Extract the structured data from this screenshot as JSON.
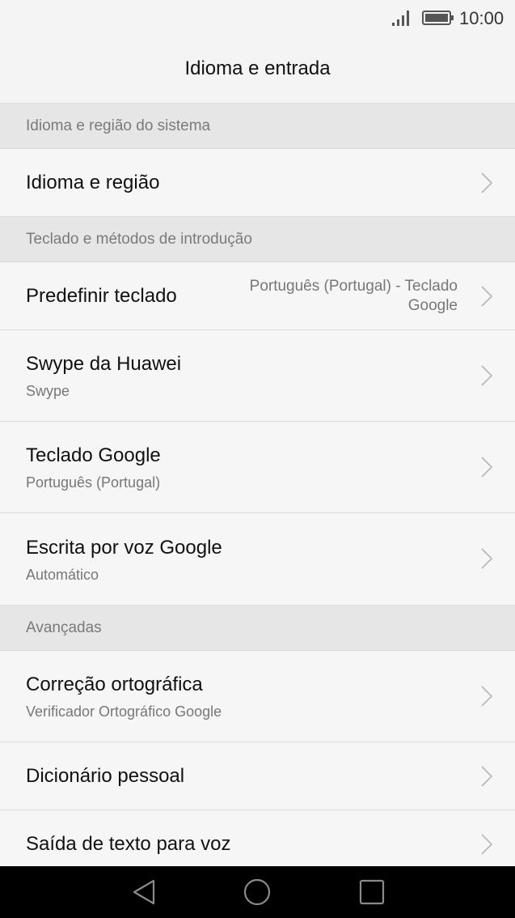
{
  "status_bar": {
    "time": "10:00",
    "signal_icon": "signal-icon",
    "battery_icon": "battery-icon"
  },
  "header": {
    "title": "Idioma e entrada"
  },
  "sections": {
    "system_language": {
      "label": "Idioma e região do sistema",
      "items": {
        "language_region": {
          "title": "Idioma e região"
        }
      }
    },
    "keyboards": {
      "label": "Teclado e métodos de introdução",
      "items": {
        "default_keyboard": {
          "title": "Predefinir teclado",
          "value": "Português (Portugal) - Teclado Google"
        },
        "huawei_swype": {
          "title": "Swype da Huawei",
          "subtitle": "Swype"
        },
        "google_keyboard": {
          "title": "Teclado Google",
          "subtitle": "Português (Portugal)"
        },
        "google_voice": {
          "title": "Escrita por voz Google",
          "subtitle": "Automático"
        }
      }
    },
    "advanced": {
      "label": "Avançadas",
      "items": {
        "spell_check": {
          "title": "Correção ortográfica",
          "subtitle": "Verificador Ortográfico Google"
        },
        "personal_dictionary": {
          "title": "Dicionário pessoal"
        },
        "tts_output": {
          "title": "Saída de texto para voz"
        }
      }
    }
  },
  "nav_bar": {
    "back_icon": "back-triangle-icon",
    "home_icon": "home-circle-icon",
    "recents_icon": "recents-square-icon"
  },
  "colors": {
    "background": "#f6f6f6",
    "section_header_bg": "#e6e6e6",
    "secondary_text": "#777777",
    "divider": "#dedede",
    "nav_bar_bg": "#000000"
  }
}
